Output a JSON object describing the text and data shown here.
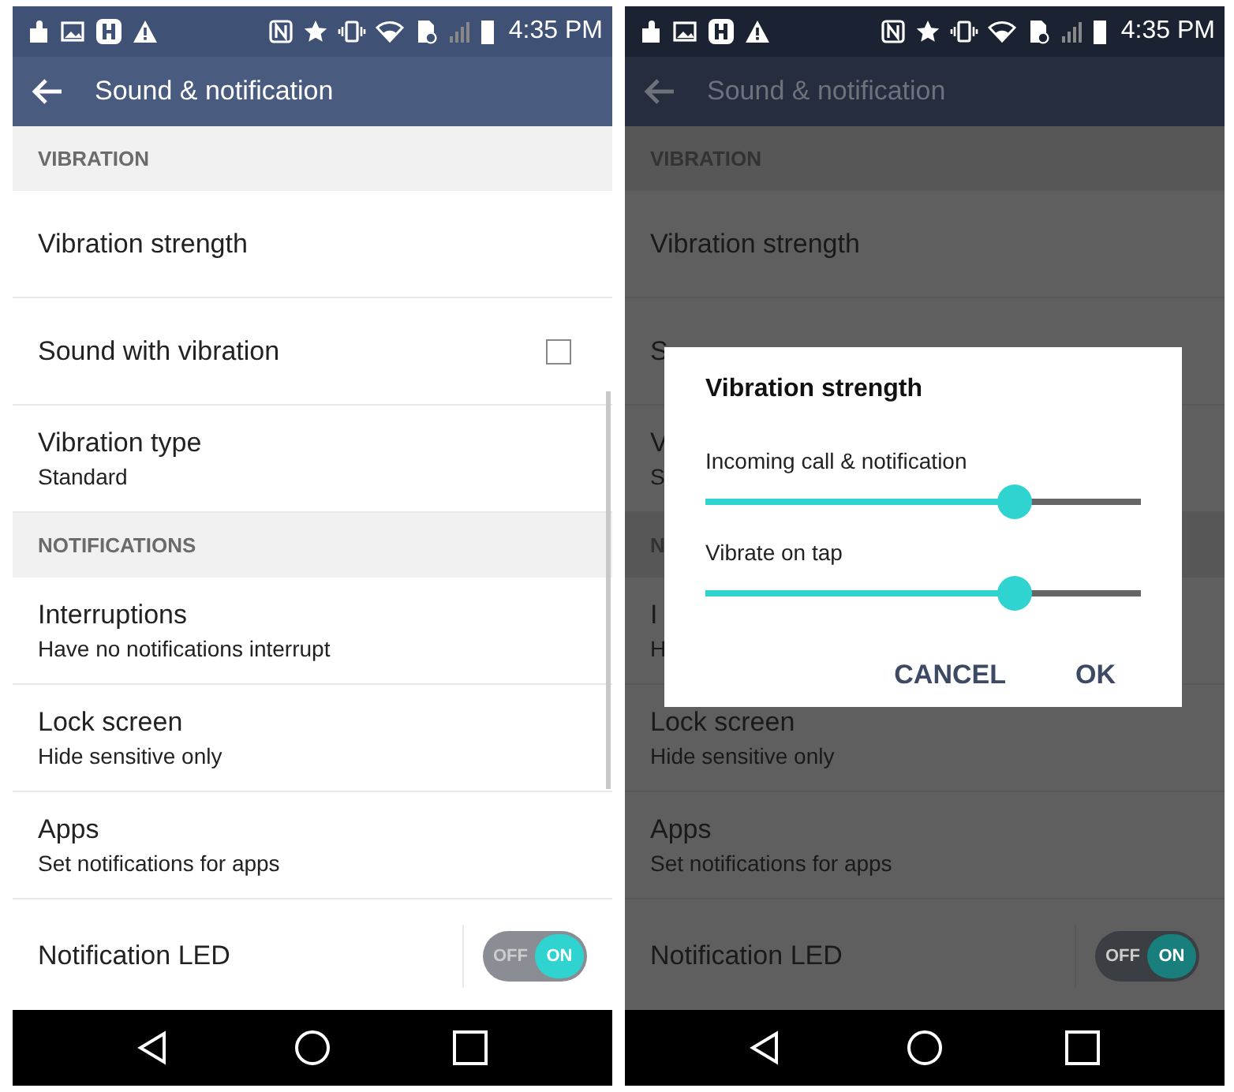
{
  "screens": [
    {
      "dimmed": false,
      "status_bar": {
        "time": "4:35 PM"
      },
      "app_bar": {
        "title": "Sound & notification"
      },
      "rows": [
        {
          "kind": "header",
          "title": "VIBRATION"
        },
        {
          "kind": "item",
          "title": "Vibration strength"
        },
        {
          "kind": "checkbox",
          "title": "Sound with vibration",
          "checked": false
        },
        {
          "kind": "item",
          "title": "Vibration type",
          "subtitle": "Standard"
        },
        {
          "kind": "header",
          "title": "NOTIFICATIONS"
        },
        {
          "kind": "item",
          "title": "Interruptions",
          "subtitle": "Have no notifications interrupt"
        },
        {
          "kind": "item",
          "title": "Lock screen",
          "subtitle": "Hide sensitive only"
        },
        {
          "kind": "item",
          "title": "Apps",
          "subtitle": "Set notifications for apps"
        },
        {
          "kind": "toggle",
          "title": "Notification LED",
          "on": true,
          "off_label": "OFF",
          "on_label": "ON"
        }
      ]
    },
    {
      "dimmed": true,
      "status_bar": {
        "time": "4:35 PM"
      },
      "app_bar": {
        "title": "Sound & notification"
      },
      "rows": [
        {
          "kind": "header",
          "title": "VIBRATION"
        },
        {
          "kind": "item",
          "title": "Vibration strength"
        },
        {
          "kind": "item",
          "title": "S"
        },
        {
          "kind": "item",
          "title": "V",
          "subtitle": "S"
        },
        {
          "kind": "header",
          "title": "N"
        },
        {
          "kind": "item",
          "title": "I",
          "subtitle": "H"
        },
        {
          "kind": "item",
          "title": "Lock screen",
          "subtitle": "Hide sensitive only"
        },
        {
          "kind": "item",
          "title": "Apps",
          "subtitle": "Set notifications for apps"
        },
        {
          "kind": "toggle",
          "title": "Notification LED",
          "on": true,
          "off_label": "OFF",
          "on_label": "ON"
        }
      ],
      "dialog": {
        "title": "Vibration strength",
        "sliders": [
          {
            "label": "Incoming call & notification",
            "level": 0.71
          },
          {
            "label": "Vibrate on tap",
            "level": 0.71
          }
        ],
        "buttons": [
          "CANCEL",
          "OK"
        ]
      }
    }
  ]
}
